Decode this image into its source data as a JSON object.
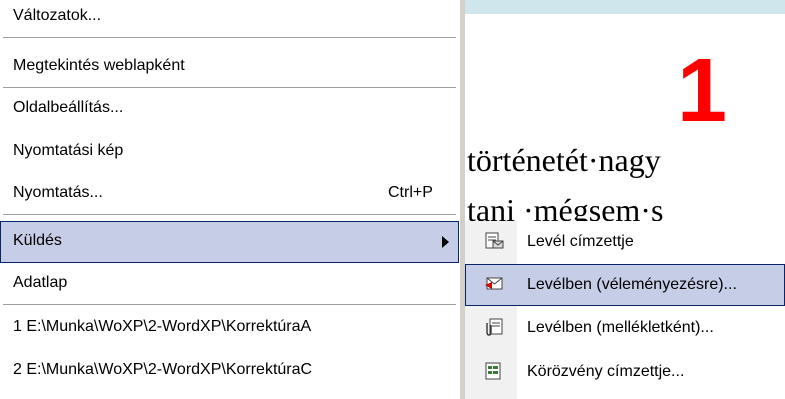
{
  "menu": {
    "items": [
      {
        "label": "Változatok...",
        "shortcut": ""
      },
      {
        "label": "Megtekintés weblapként",
        "shortcut": ""
      },
      {
        "label": "Oldalbeállítás...",
        "shortcut": ""
      },
      {
        "label": "Nyomtatási kép",
        "shortcut": ""
      },
      {
        "label": "Nyomtatás...",
        "shortcut": "Ctrl+P"
      },
      {
        "label": "Küldés",
        "shortcut": ""
      },
      {
        "label": "Adatlap",
        "shortcut": ""
      },
      {
        "label": "1 E:\\Munka\\WoXP\\2-WordXP\\KorrektúraA",
        "shortcut": ""
      },
      {
        "label": "2 E:\\Munka\\WoXP\\2-WordXP\\KorrektúraC",
        "shortcut": ""
      }
    ]
  },
  "submenu": {
    "items": [
      {
        "label": "Levél címzettje",
        "icon": "mail-recipient-icon"
      },
      {
        "label": "Levélben (véleményezésre)...",
        "icon": "mail-review-icon"
      },
      {
        "label": "Levélben (mellékletként)...",
        "icon": "mail-attachment-icon"
      },
      {
        "label": "Körözvény címzettje...",
        "icon": "routing-recipient-icon"
      }
    ]
  },
  "document": {
    "big_number": "1",
    "line1": "történetét·nagy",
    "line2": "tani ·mégsem·s"
  },
  "colors": {
    "highlight_bg": "#c6cde6",
    "highlight_border": "#0a246a",
    "number_color": "#ff0000",
    "background": "#cfe6ec"
  }
}
